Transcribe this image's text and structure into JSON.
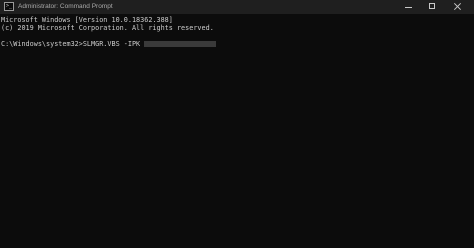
{
  "window": {
    "title": "Administrator: Command Prompt",
    "icon": "command-prompt-icon",
    "controls": {
      "minimize_icon": "minimize-icon",
      "maximize_icon": "maximize-icon",
      "close_icon": "close-icon"
    }
  },
  "console": {
    "lines": [
      "Microsoft Windows [Version 10.0.18362.388]",
      "(c) 2019 Microsoft Corporation. All rights reserved."
    ],
    "prompt": "C:\\Windows\\system32>",
    "command": "SLMGR.VBS -IPK",
    "redacted_icon": "redacted-key-block"
  },
  "colors": {
    "background": "#0c0c0c",
    "titlebar": "#1f1f1f",
    "text": "#cccccc"
  }
}
